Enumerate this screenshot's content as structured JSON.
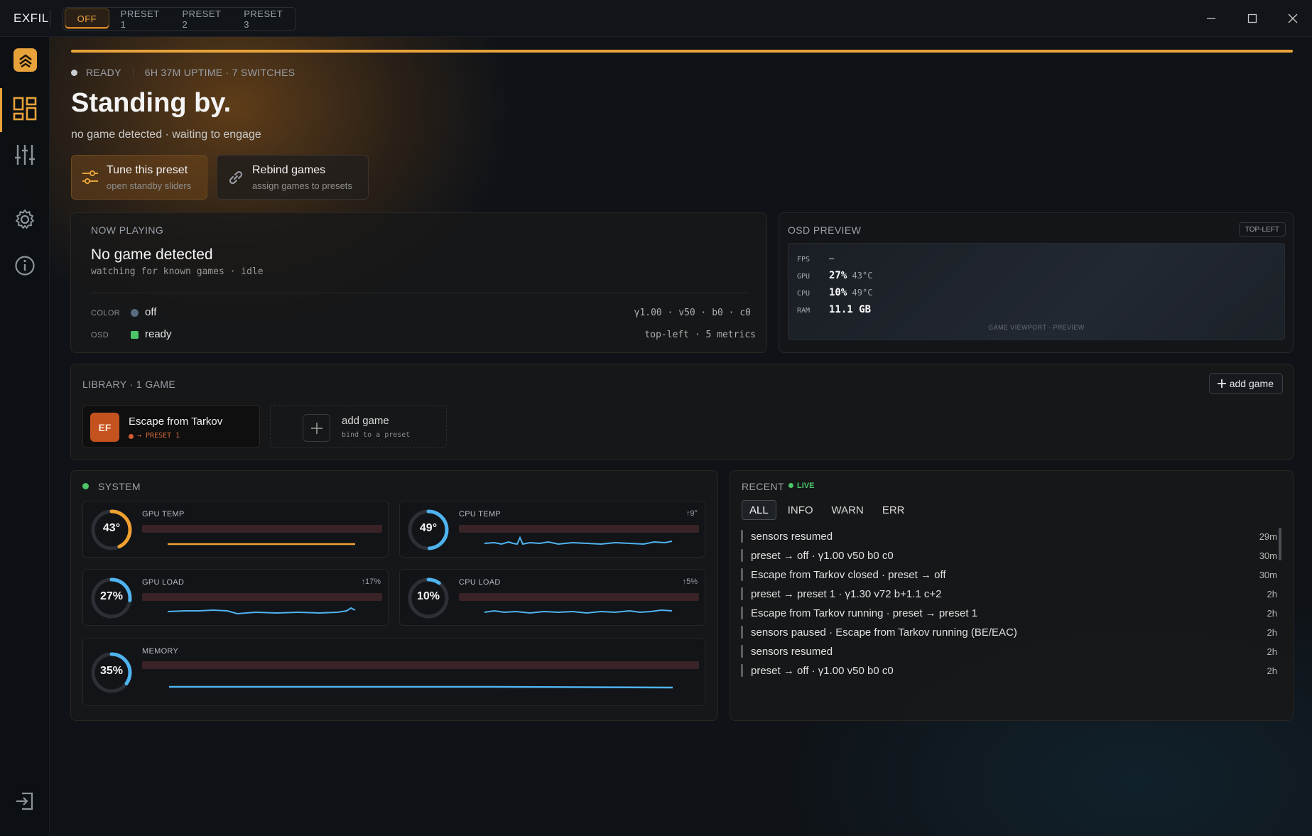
{
  "app": {
    "brand": "EXFIL"
  },
  "presets": [
    {
      "label": "OFF",
      "active": true
    },
    {
      "label": "PRESET 1",
      "active": false
    },
    {
      "label": "PRESET 2",
      "active": false
    },
    {
      "label": "PRESET 3",
      "active": false
    }
  ],
  "window_controls": {
    "minimize": "—",
    "maximize": "☐",
    "close": "✕"
  },
  "sidebar": {
    "items": [
      "dashboard-icon",
      "sliders-icon",
      "gear-icon",
      "info-icon"
    ],
    "active": "dashboard-icon",
    "bottom": "exit-icon"
  },
  "status": {
    "state": "READY",
    "meta": "6H 37M UPTIME · 7 SWITCHES",
    "dot_color": "#c9ccd1"
  },
  "hero": {
    "title": "Standing by.",
    "subtitle": "no game detected · waiting to engage"
  },
  "actions": [
    {
      "title": "Tune this preset",
      "sub": "open standby sliders",
      "icon": "sliders-icon"
    },
    {
      "title": "Rebind games",
      "sub": "assign games to presets",
      "icon": "link-icon"
    }
  ],
  "now_playing": {
    "header": "NOW PLAYING",
    "title": "No game detected",
    "sub": "watching for known games · idle",
    "rows": [
      {
        "label": "COLOR",
        "value": "off",
        "dot": "#5a6a80",
        "right": "γ1.00 · v50 · b0 · c0"
      },
      {
        "label": "OSD",
        "value": "ready",
        "dot": "#4cc46a",
        "right": "top-left · 5 metrics"
      }
    ]
  },
  "osd": {
    "header": "OSD PREVIEW",
    "badge": "TOP-LEFT",
    "rows": [
      {
        "key": "FPS",
        "value": "—",
        "extra": ""
      },
      {
        "key": "GPU",
        "value": "27%",
        "extra": "43°C"
      },
      {
        "key": "CPU",
        "value": "10%",
        "extra": "49°C"
      },
      {
        "key": "RAM",
        "value": "11.1 GB",
        "extra": ""
      }
    ],
    "caption": "GAME VIEWPORT · PREVIEW"
  },
  "library": {
    "header": "LIBRARY · 1 GAME",
    "add_button": "add game",
    "games": [
      {
        "badge": "EF",
        "name": "Escape from Tarkov",
        "preset": "→ PRESET 1"
      }
    ],
    "add_tile": {
      "title": "add game",
      "sub": "bind to a preset"
    }
  },
  "system": {
    "header": "SYSTEM",
    "metrics": [
      {
        "label": "GPU TEMP",
        "value": "43°",
        "level": 0.43,
        "delta": "",
        "color": "#f0a030"
      },
      {
        "label": "CPU TEMP",
        "value": "49°",
        "level": 0.49,
        "delta": "↑9°",
        "color": "#4fb3ef"
      },
      {
        "label": "GPU LOAD",
        "value": "27%",
        "level": 0.27,
        "delta": "↑17%",
        "color": "#4fb3ef"
      },
      {
        "label": "CPU LOAD",
        "value": "10%",
        "level": 0.1,
        "delta": "↑5%",
        "color": "#4fb3ef"
      },
      {
        "label": "MEMORY",
        "value": "35%",
        "level": 0.35,
        "delta": "",
        "color": "#4fb3ef"
      }
    ]
  },
  "recent": {
    "header": "RECENT",
    "live": "LIVE",
    "filters": [
      {
        "label": "ALL",
        "active": true
      },
      {
        "label": "INFO"
      },
      {
        "label": "WARN"
      },
      {
        "label": "ERR"
      }
    ],
    "entries": [
      {
        "text": "sensors resumed",
        "time": "29m"
      },
      {
        "text": "preset → off · γ1.00 v50 b0 c0",
        "time": "30m"
      },
      {
        "text": "Escape from Tarkov closed · preset → off",
        "time": "30m"
      },
      {
        "text": "preset → preset 1 · γ1.30 v72 b+1.1 c+2",
        "time": "2h"
      },
      {
        "text": "Escape from Tarkov running · preset → preset 1",
        "time": "2h"
      },
      {
        "text": "sensors paused · Escape from Tarkov running (BE/EAC)",
        "time": "2h"
      },
      {
        "text": "sensors resumed",
        "time": "2h"
      },
      {
        "text": "preset → off · γ1.00 v50 b0 c0",
        "time": "2h"
      }
    ]
  },
  "colors": {
    "accent": "#e8a23a",
    "live": "#4cc46a",
    "sparkline": "#4fb3ef"
  }
}
